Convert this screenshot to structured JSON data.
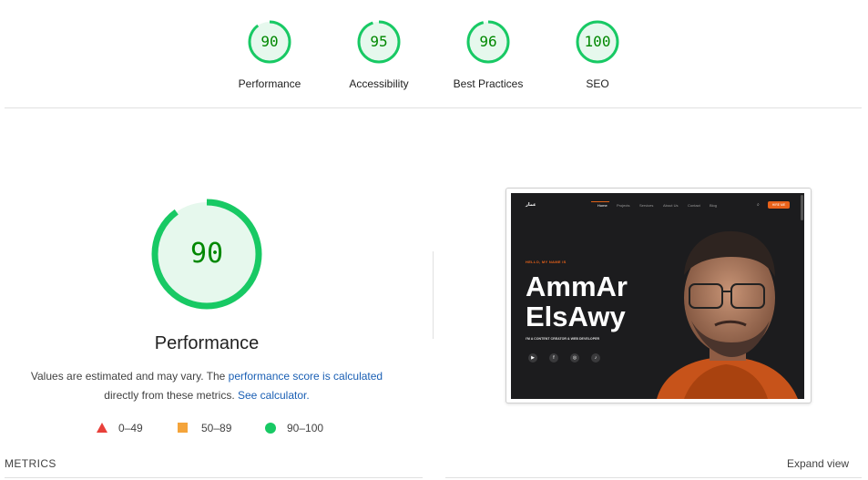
{
  "summary_gauges": [
    {
      "score": "90",
      "label": "Performance"
    },
    {
      "score": "95",
      "label": "Accessibility"
    },
    {
      "score": "96",
      "label": "Best Practices"
    },
    {
      "score": "100",
      "label": "SEO"
    }
  ],
  "main": {
    "score": "90",
    "title": "Performance",
    "description_prefix": "Values are estimated and may vary. The ",
    "link_score": "performance score is calculated",
    "description_middle": " directly from these metrics. ",
    "link_calculator": "See calculator.",
    "legend": [
      {
        "range": "0–49",
        "shape": "triangle",
        "color": "#e8403a"
      },
      {
        "range": "50–89",
        "shape": "square",
        "color": "#f4a43b"
      },
      {
        "range": "90–100",
        "shape": "circle",
        "color": "#18c964"
      }
    ]
  },
  "preview": {
    "logo": "عمار",
    "nav": [
      "Home",
      "Projects",
      "Services",
      "About Us",
      "Contact",
      "Blog"
    ],
    "cta": "HIRE ME",
    "hello": "HELLO, MY NAME IS",
    "name_line1": "AmmAr",
    "name_line2": "ElsAwy",
    "subtitle": "I'M A CONTENT CREATOR & WEB DEVELOPER",
    "socials": [
      "youtube-icon",
      "facebook-icon",
      "instagram-icon",
      "tiktok-icon"
    ]
  },
  "footer": {
    "metrics_label": "METRICS",
    "expand_label": "Expand view"
  },
  "colors": {
    "pass_green": "#18c964",
    "score_text": "#008800",
    "gauge_bg": "#e6f8ed",
    "accent_orange": "#e8621a",
    "link_blue": "#1a5fb4"
  }
}
